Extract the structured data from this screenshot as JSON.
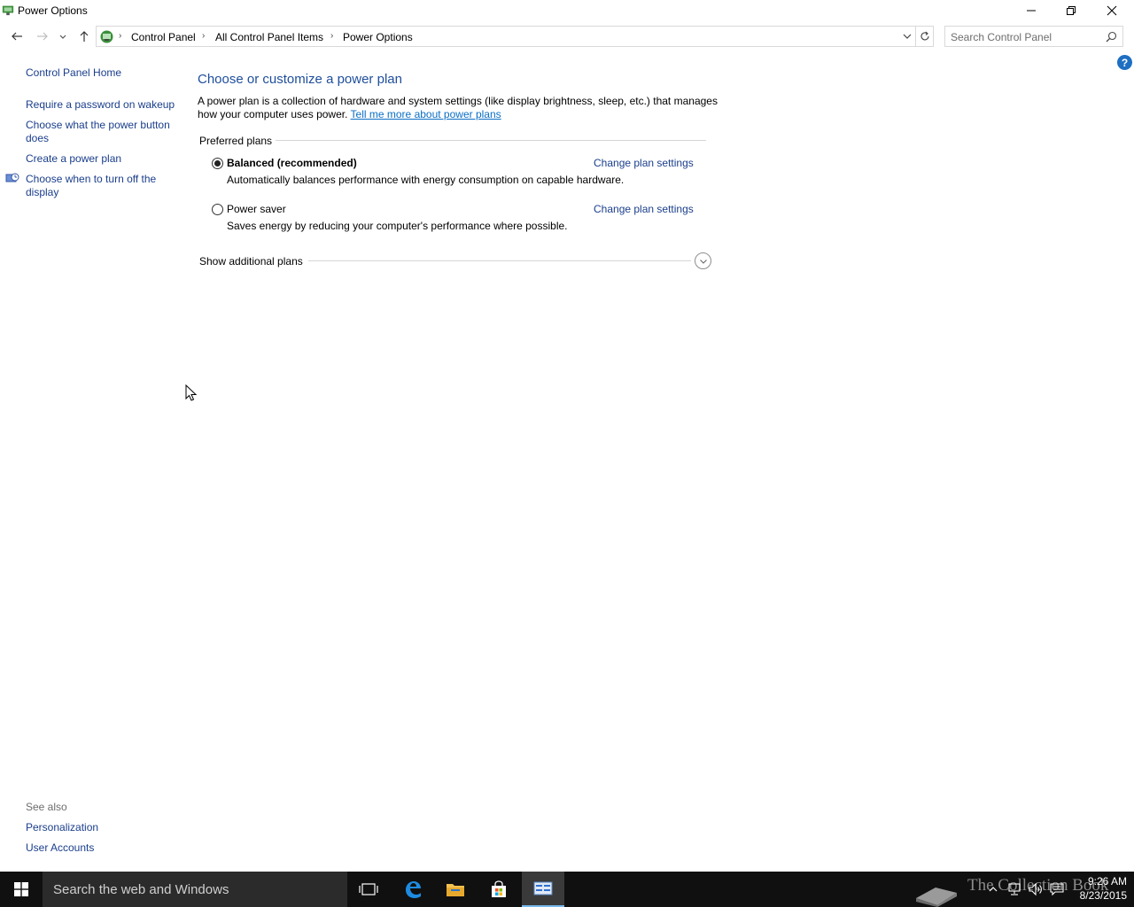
{
  "window": {
    "title": "Power Options"
  },
  "address": {
    "breadcrumbs": [
      "Control Panel",
      "All Control Panel Items",
      "Power Options"
    ],
    "search_placeholder": "Search Control Panel"
  },
  "left_pane": {
    "home": "Control Panel Home",
    "items": [
      "Require a password on wakeup",
      "Choose what the power button does",
      "Create a power plan",
      "Choose when to turn off the display"
    ],
    "see_also_title": "See also",
    "see_also": [
      "Personalization",
      "User Accounts"
    ]
  },
  "main": {
    "title": "Choose or customize a power plan",
    "intro": "A power plan is a collection of hardware and system settings (like display brightness, sleep, etc.) that manages how your computer uses power.",
    "intro_link": "Tell me more about power plans",
    "group_title": "Preferred plans",
    "plans": [
      {
        "name": "Balanced (recommended)",
        "description": "Automatically balances performance with energy consumption on capable hardware.",
        "link": "Change plan settings",
        "selected": true
      },
      {
        "name": "Power saver",
        "description": "Saves energy by reducing your computer's performance where possible.",
        "link": "Change plan settings",
        "selected": false
      }
    ],
    "additional_plans": "Show additional plans"
  },
  "help": {
    "label": "?"
  },
  "taskbar": {
    "search_text": "Search the web and Windows",
    "watermark": "The Collection Book",
    "time": "9:26 AM",
    "date": "8/23/2015"
  },
  "colors": {
    "link": "#1a3e8c",
    "title_blue": "#1e4e9c",
    "accent": "#1e6fc2",
    "taskbar": "#101010"
  }
}
